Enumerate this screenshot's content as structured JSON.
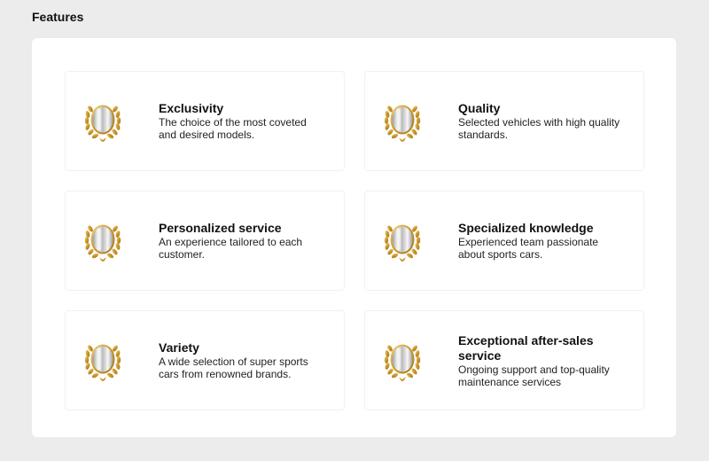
{
  "header": {
    "title": "Features"
  },
  "features": [
    {
      "title": "Exclusivity",
      "description": "The choice of the most coveted and desired models.",
      "icon": "laurel-medal-icon"
    },
    {
      "title": "Quality",
      "description": "Selected vehicles with high quality standards.",
      "icon": "laurel-medal-icon"
    },
    {
      "title": "Personalized service",
      "description": "An experience tailored to each customer.",
      "icon": "laurel-medal-icon"
    },
    {
      "title": "Specialized knowledge",
      "description": "Experienced team passionate about sports cars.",
      "icon": "laurel-medal-icon"
    },
    {
      "title": "Variety",
      "description": "A wide selection of super sports cars from renowned brands.",
      "icon": "laurel-medal-icon"
    },
    {
      "title": "Exceptional after-sales service",
      "description": "Ongoing support and top-quality maintenance services",
      "icon": "laurel-medal-icon"
    }
  ],
  "colors": {
    "page_background": "#ececec",
    "panel_background": "#ffffff",
    "laurel_gold": "#c99a2e",
    "medal_silver": "#d8d8d8"
  }
}
